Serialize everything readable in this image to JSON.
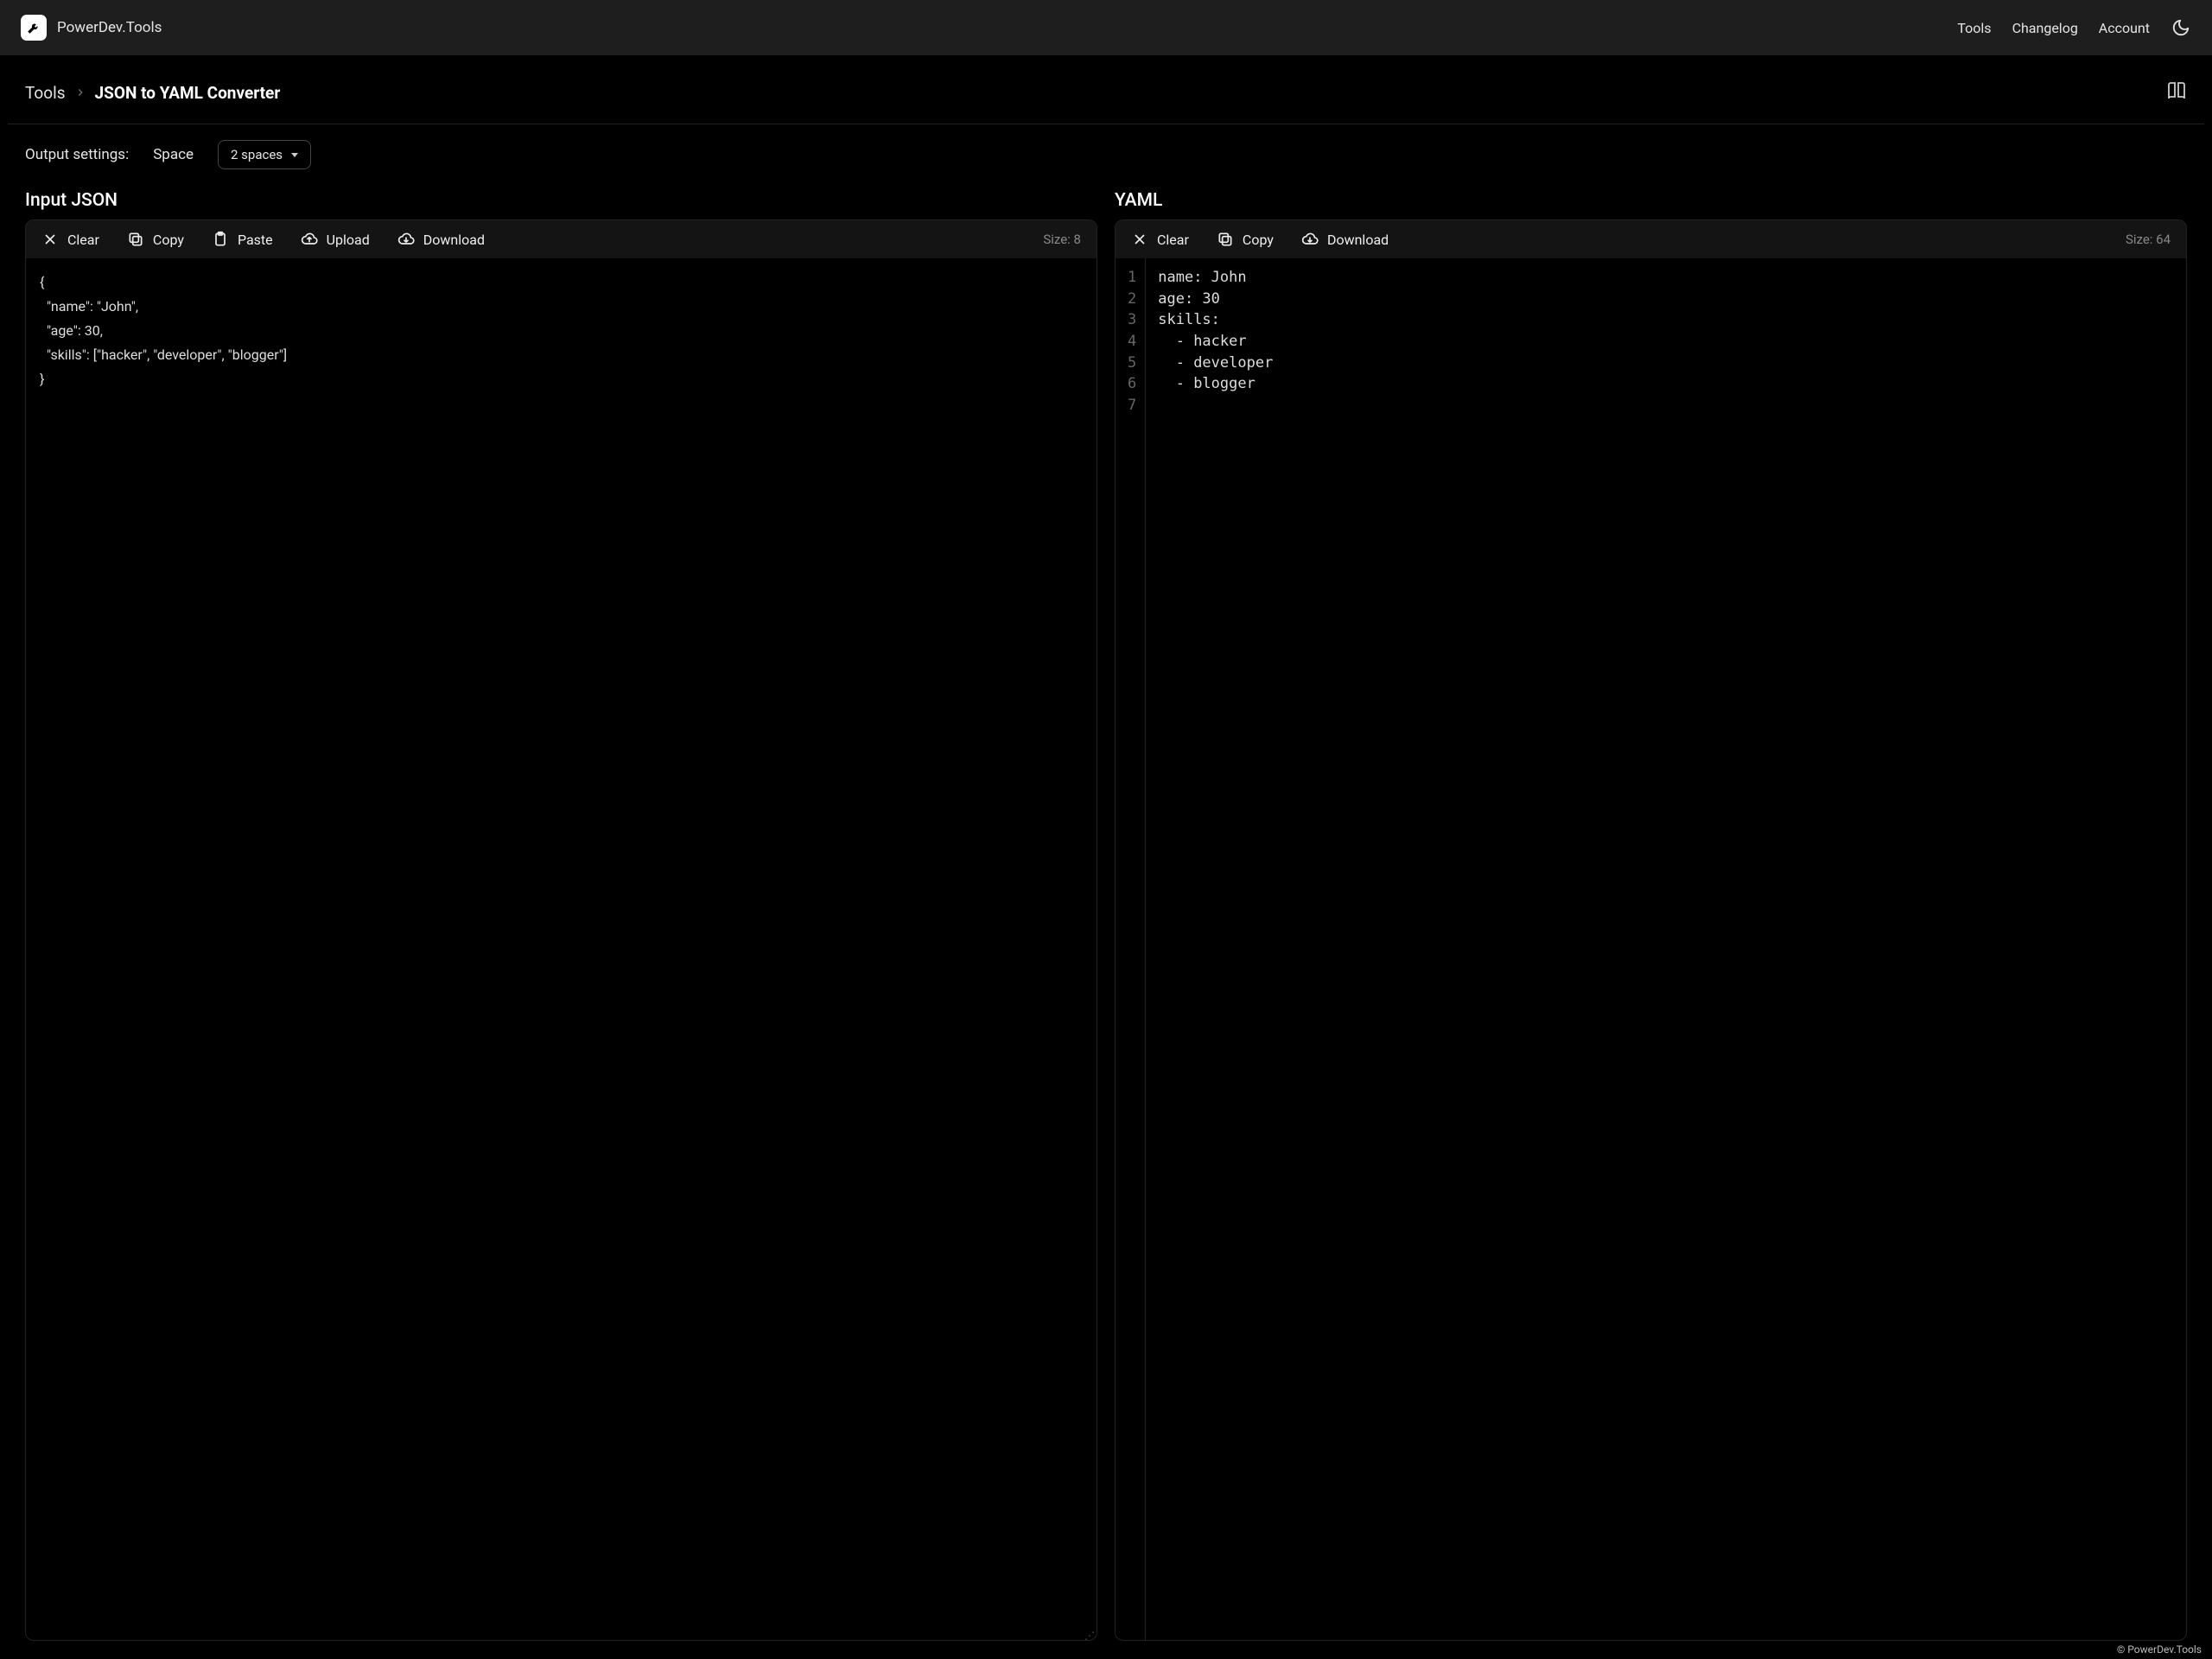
{
  "brand": {
    "name": "PowerDev.Tools"
  },
  "nav": {
    "tools": "Tools",
    "changelog": "Changelog",
    "account": "Account"
  },
  "breadcrumb": {
    "parent": "Tools",
    "current": "JSON to YAML Converter"
  },
  "settings": {
    "label": "Output settings:",
    "space_label": "Space",
    "space_value": "2 spaces"
  },
  "input_panel": {
    "title": "Input JSON",
    "toolbar": {
      "clear": "Clear",
      "copy": "Copy",
      "paste": "Paste",
      "upload": "Upload",
      "download": "Download",
      "size": "Size: 8"
    },
    "content_lines": [
      "{",
      "  \"name\": \"John\",",
      "  \"age\": 30,",
      "  \"skills\": [\"hacker\", \"developer\", \"blogger\"]",
      "}"
    ]
  },
  "output_panel": {
    "title": "YAML",
    "toolbar": {
      "clear": "Clear",
      "copy": "Copy",
      "download": "Download",
      "size": "Size: 64"
    },
    "line_numbers": [
      "1",
      "2",
      "3",
      "4",
      "5",
      "6",
      "7"
    ],
    "content_lines": [
      "name: John",
      "age: 30",
      "skills:",
      "  - hacker",
      "  - developer",
      "  - blogger",
      ""
    ]
  },
  "footer": {
    "copyright": "© PowerDev.Tools"
  }
}
